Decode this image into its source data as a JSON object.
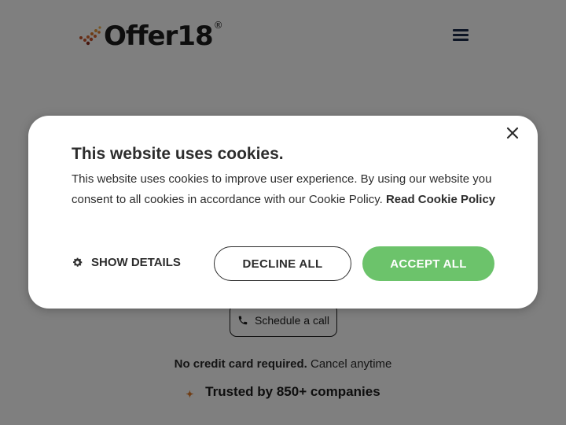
{
  "header": {
    "logo_text": "Offer18",
    "logo_reg": "®",
    "menu_icon": "hamburger-icon"
  },
  "hero": {
    "schedule_label": "Schedule a call",
    "no_credit_bold": "No credit card required.",
    "no_credit_rest": "Cancel anytime",
    "trusted_label": "Trusted by 850+ companies",
    "star_glyph": "✦"
  },
  "cookie_banner": {
    "title": "This website uses cookies.",
    "body_text": "This website uses cookies to improve user experience. By using our website you consent to all cookies in accordance with our Cookie Policy.",
    "policy_link": "Read Cookie Policy",
    "show_details_label": "SHOW DETAILS",
    "decline_label": "DECLINE ALL",
    "accept_label": "ACCEPT ALL",
    "close_icon": "close-icon"
  },
  "colors": {
    "accept_green": "#6cc36b",
    "overlay": "rgba(0,0,0,0.5)",
    "brand_orange": "#c9522a",
    "menu_navy": "#1a2b4a"
  }
}
